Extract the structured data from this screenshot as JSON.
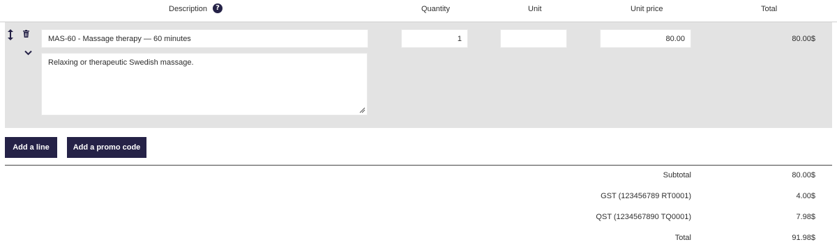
{
  "table": {
    "headers": {
      "description": "Description",
      "quantity": "Quantity",
      "unit": "Unit",
      "unit_price": "Unit price",
      "total": "Total"
    }
  },
  "line_item": {
    "name": "MAS-60 - Massage therapy — 60 minutes",
    "description": "Relaxing or therapeutic Swedish massage.",
    "quantity": "1",
    "unit": "",
    "unit_price": "80.00",
    "total": "80.00$"
  },
  "actions": {
    "add_line": "Add a line",
    "add_promo": "Add a promo code"
  },
  "summary": {
    "subtotal_label": "Subtotal",
    "subtotal": "80.00$",
    "gst_label": "GST (123456789 RT0001)",
    "gst": "4.00$",
    "qst_label": "QST (1234567890 TQ0001)",
    "qst": "7.98$",
    "total_label": "Total",
    "total": "91.98$"
  },
  "icons": {
    "help": "question-circle-icon",
    "drag": "drag-handle-icon",
    "delete": "trash-icon",
    "expand": "chevron-down-icon"
  },
  "colors": {
    "accent": "#252247",
    "row_bg": "#e3e3e3"
  }
}
